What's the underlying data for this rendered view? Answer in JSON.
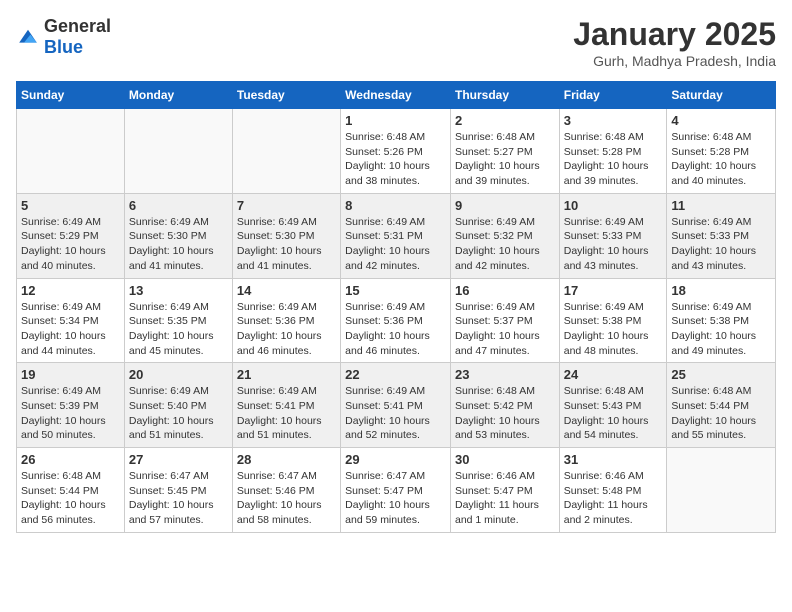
{
  "header": {
    "logo_general": "General",
    "logo_blue": "Blue",
    "title": "January 2025",
    "subtitle": "Gurh, Madhya Pradesh, India"
  },
  "weekdays": [
    "Sunday",
    "Monday",
    "Tuesday",
    "Wednesday",
    "Thursday",
    "Friday",
    "Saturday"
  ],
  "weeks": [
    [
      {
        "day": "",
        "sunrise": "",
        "sunset": "",
        "daylight": ""
      },
      {
        "day": "",
        "sunrise": "",
        "sunset": "",
        "daylight": ""
      },
      {
        "day": "",
        "sunrise": "",
        "sunset": "",
        "daylight": ""
      },
      {
        "day": "1",
        "sunrise": "Sunrise: 6:48 AM",
        "sunset": "Sunset: 5:26 PM",
        "daylight": "Daylight: 10 hours and 38 minutes."
      },
      {
        "day": "2",
        "sunrise": "Sunrise: 6:48 AM",
        "sunset": "Sunset: 5:27 PM",
        "daylight": "Daylight: 10 hours and 39 minutes."
      },
      {
        "day": "3",
        "sunrise": "Sunrise: 6:48 AM",
        "sunset": "Sunset: 5:28 PM",
        "daylight": "Daylight: 10 hours and 39 minutes."
      },
      {
        "day": "4",
        "sunrise": "Sunrise: 6:48 AM",
        "sunset": "Sunset: 5:28 PM",
        "daylight": "Daylight: 10 hours and 40 minutes."
      }
    ],
    [
      {
        "day": "5",
        "sunrise": "Sunrise: 6:49 AM",
        "sunset": "Sunset: 5:29 PM",
        "daylight": "Daylight: 10 hours and 40 minutes."
      },
      {
        "day": "6",
        "sunrise": "Sunrise: 6:49 AM",
        "sunset": "Sunset: 5:30 PM",
        "daylight": "Daylight: 10 hours and 41 minutes."
      },
      {
        "day": "7",
        "sunrise": "Sunrise: 6:49 AM",
        "sunset": "Sunset: 5:30 PM",
        "daylight": "Daylight: 10 hours and 41 minutes."
      },
      {
        "day": "8",
        "sunrise": "Sunrise: 6:49 AM",
        "sunset": "Sunset: 5:31 PM",
        "daylight": "Daylight: 10 hours and 42 minutes."
      },
      {
        "day": "9",
        "sunrise": "Sunrise: 6:49 AM",
        "sunset": "Sunset: 5:32 PM",
        "daylight": "Daylight: 10 hours and 42 minutes."
      },
      {
        "day": "10",
        "sunrise": "Sunrise: 6:49 AM",
        "sunset": "Sunset: 5:33 PM",
        "daylight": "Daylight: 10 hours and 43 minutes."
      },
      {
        "day": "11",
        "sunrise": "Sunrise: 6:49 AM",
        "sunset": "Sunset: 5:33 PM",
        "daylight": "Daylight: 10 hours and 43 minutes."
      }
    ],
    [
      {
        "day": "12",
        "sunrise": "Sunrise: 6:49 AM",
        "sunset": "Sunset: 5:34 PM",
        "daylight": "Daylight: 10 hours and 44 minutes."
      },
      {
        "day": "13",
        "sunrise": "Sunrise: 6:49 AM",
        "sunset": "Sunset: 5:35 PM",
        "daylight": "Daylight: 10 hours and 45 minutes."
      },
      {
        "day": "14",
        "sunrise": "Sunrise: 6:49 AM",
        "sunset": "Sunset: 5:36 PM",
        "daylight": "Daylight: 10 hours and 46 minutes."
      },
      {
        "day": "15",
        "sunrise": "Sunrise: 6:49 AM",
        "sunset": "Sunset: 5:36 PM",
        "daylight": "Daylight: 10 hours and 46 minutes."
      },
      {
        "day": "16",
        "sunrise": "Sunrise: 6:49 AM",
        "sunset": "Sunset: 5:37 PM",
        "daylight": "Daylight: 10 hours and 47 minutes."
      },
      {
        "day": "17",
        "sunrise": "Sunrise: 6:49 AM",
        "sunset": "Sunset: 5:38 PM",
        "daylight": "Daylight: 10 hours and 48 minutes."
      },
      {
        "day": "18",
        "sunrise": "Sunrise: 6:49 AM",
        "sunset": "Sunset: 5:38 PM",
        "daylight": "Daylight: 10 hours and 49 minutes."
      }
    ],
    [
      {
        "day": "19",
        "sunrise": "Sunrise: 6:49 AM",
        "sunset": "Sunset: 5:39 PM",
        "daylight": "Daylight: 10 hours and 50 minutes."
      },
      {
        "day": "20",
        "sunrise": "Sunrise: 6:49 AM",
        "sunset": "Sunset: 5:40 PM",
        "daylight": "Daylight: 10 hours and 51 minutes."
      },
      {
        "day": "21",
        "sunrise": "Sunrise: 6:49 AM",
        "sunset": "Sunset: 5:41 PM",
        "daylight": "Daylight: 10 hours and 51 minutes."
      },
      {
        "day": "22",
        "sunrise": "Sunrise: 6:49 AM",
        "sunset": "Sunset: 5:41 PM",
        "daylight": "Daylight: 10 hours and 52 minutes."
      },
      {
        "day": "23",
        "sunrise": "Sunrise: 6:48 AM",
        "sunset": "Sunset: 5:42 PM",
        "daylight": "Daylight: 10 hours and 53 minutes."
      },
      {
        "day": "24",
        "sunrise": "Sunrise: 6:48 AM",
        "sunset": "Sunset: 5:43 PM",
        "daylight": "Daylight: 10 hours and 54 minutes."
      },
      {
        "day": "25",
        "sunrise": "Sunrise: 6:48 AM",
        "sunset": "Sunset: 5:44 PM",
        "daylight": "Daylight: 10 hours and 55 minutes."
      }
    ],
    [
      {
        "day": "26",
        "sunrise": "Sunrise: 6:48 AM",
        "sunset": "Sunset: 5:44 PM",
        "daylight": "Daylight: 10 hours and 56 minutes."
      },
      {
        "day": "27",
        "sunrise": "Sunrise: 6:47 AM",
        "sunset": "Sunset: 5:45 PM",
        "daylight": "Daylight: 10 hours and 57 minutes."
      },
      {
        "day": "28",
        "sunrise": "Sunrise: 6:47 AM",
        "sunset": "Sunset: 5:46 PM",
        "daylight": "Daylight: 10 hours and 58 minutes."
      },
      {
        "day": "29",
        "sunrise": "Sunrise: 6:47 AM",
        "sunset": "Sunset: 5:47 PM",
        "daylight": "Daylight: 10 hours and 59 minutes."
      },
      {
        "day": "30",
        "sunrise": "Sunrise: 6:46 AM",
        "sunset": "Sunset: 5:47 PM",
        "daylight": "Daylight: 11 hours and 1 minute."
      },
      {
        "day": "31",
        "sunrise": "Sunrise: 6:46 AM",
        "sunset": "Sunset: 5:48 PM",
        "daylight": "Daylight: 11 hours and 2 minutes."
      },
      {
        "day": "",
        "sunrise": "",
        "sunset": "",
        "daylight": ""
      }
    ]
  ]
}
